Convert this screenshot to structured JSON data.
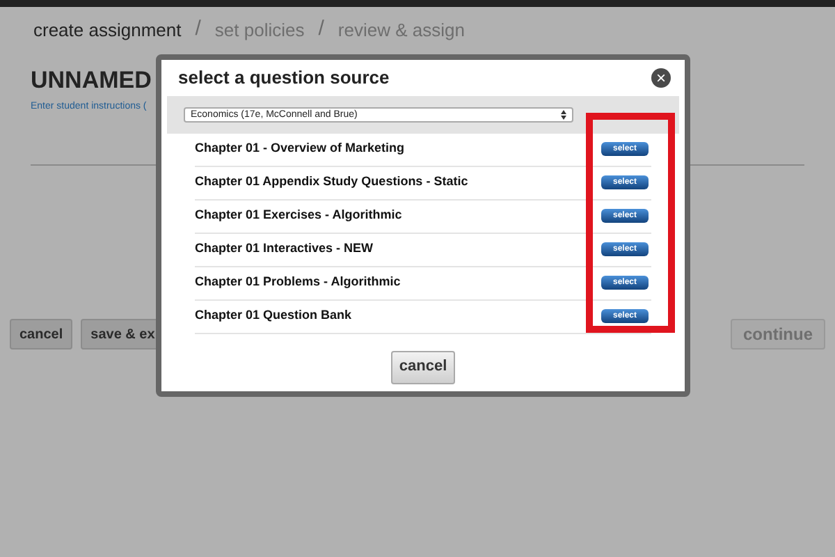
{
  "steps": [
    {
      "label": "create assignment",
      "selected": true
    },
    {
      "label": "set policies",
      "selected": false
    },
    {
      "label": "review & assign",
      "selected": false
    }
  ],
  "step_separator": "/",
  "title": "UNNAMED",
  "instructions_link": "Enter student instructions (",
  "page_buttons": [
    {
      "label": "cancel",
      "disabled": false
    },
    {
      "label": "save & ex",
      "disabled": false
    }
  ],
  "continue_button": {
    "label": "continue",
    "disabled": true
  },
  "dialog": {
    "title": "select a question source",
    "close": "×",
    "source": "Economics (17e, McConnell and Brue)",
    "rows": [
      {
        "name": "Chapter 01 - Overview of Marketing",
        "action": "select"
      },
      {
        "name": "Chapter 01 Appendix Study Questions - Static",
        "action": "select"
      },
      {
        "name": "Chapter 01 Exercises - Algorithmic",
        "action": "select"
      },
      {
        "name": "Chapter 01 Interactives - NEW",
        "action": "select"
      },
      {
        "name": "Chapter 01 Problems - Algorithmic",
        "action": "select"
      },
      {
        "name": "Chapter 01 Question Bank",
        "action": "select"
      }
    ],
    "cancel": "cancel"
  }
}
